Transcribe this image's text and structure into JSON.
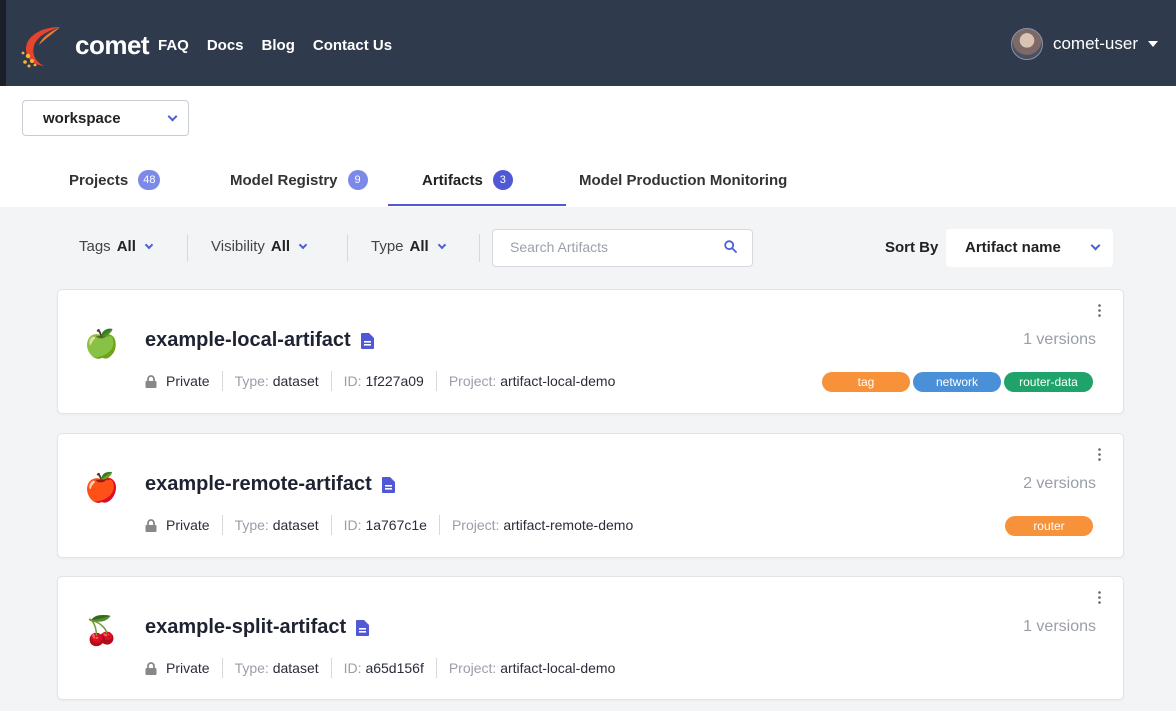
{
  "header": {
    "brand": "comet",
    "nav": [
      "FAQ",
      "Docs",
      "Blog",
      "Contact Us"
    ],
    "username": "comet-user"
  },
  "workspace": {
    "selected": "workspace"
  },
  "tabs": [
    {
      "label": "Projects",
      "count": "48"
    },
    {
      "label": "Model Registry",
      "count": "9"
    },
    {
      "label": "Artifacts",
      "count": "3",
      "active": true
    },
    {
      "label": "Model Production Monitoring"
    }
  ],
  "filters": {
    "tags": {
      "label": "Tags",
      "value": "All"
    },
    "visibility": {
      "label": "Visibility",
      "value": "All"
    },
    "type": {
      "label": "Type",
      "value": "All"
    },
    "search_placeholder": "Search Artifacts",
    "sort_label": "Sort By",
    "sort_value": "Artifact name"
  },
  "artifacts": [
    {
      "icon": "green-apple-icon",
      "name": "example-local-artifact",
      "privacy": "Private",
      "type_label": "Type:",
      "type": "dataset",
      "id_label": "ID:",
      "id": "1f227a09",
      "project_label": "Project:",
      "project": "artifact-local-demo",
      "versions": "1 versions",
      "tags": [
        {
          "label": "tag",
          "color": "#f7923a"
        },
        {
          "label": "network",
          "color": "#4a90d9"
        },
        {
          "label": "router-data",
          "color": "#1fa36b"
        }
      ]
    },
    {
      "icon": "red-apple-icon",
      "name": "example-remote-artifact",
      "privacy": "Private",
      "type_label": "Type:",
      "type": "dataset",
      "id_label": "ID:",
      "id": "1a767c1e",
      "project_label": "Project:",
      "project": "artifact-remote-demo",
      "versions": "2 versions",
      "tags": [
        {
          "label": "router",
          "color": "#f7923a"
        }
      ]
    },
    {
      "icon": "cherries-icon",
      "name": "example-split-artifact",
      "privacy": "Private",
      "type_label": "Type:",
      "type": "dataset",
      "id_label": "ID:",
      "id": "a65d156f",
      "project_label": "Project:",
      "project": "artifact-local-demo",
      "versions": "1 versions",
      "tags": []
    }
  ],
  "colors": {
    "topbar": "#303a4d",
    "accent": "#5058d6",
    "badge": "#7d89e8"
  }
}
